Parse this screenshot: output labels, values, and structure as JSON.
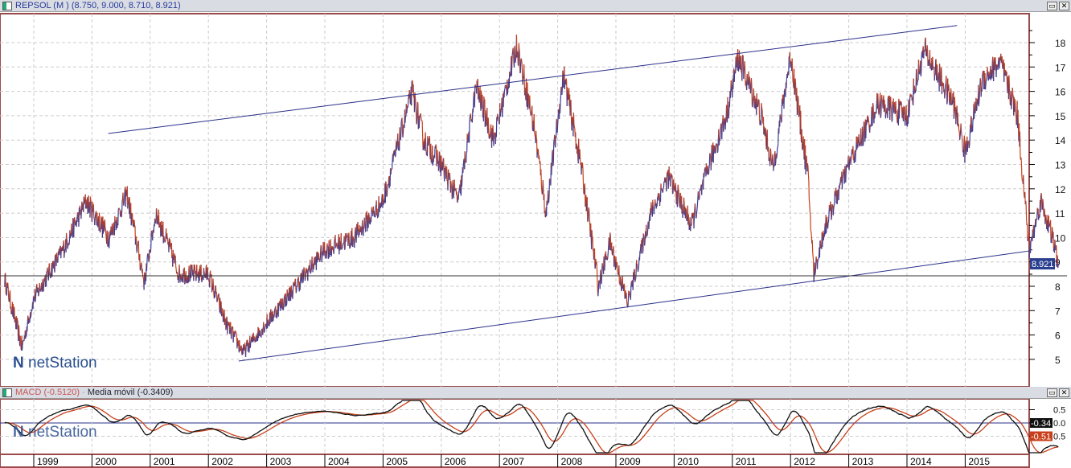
{
  "header": {
    "title": "REPSOL (M ) (8.750, 9.000, 8.710, 8.921)"
  },
  "macd_header": {
    "macd": "MACD (-0.5120)",
    "sep": " - ",
    "ma": "Media móvil (-0.3409)"
  },
  "logo": "netStation",
  "colors": {
    "up": "#3a3f9a",
    "down": "#c8401a",
    "frame": "#9a4a4a",
    "trend": "#2a2f8a"
  },
  "chart_data": [
    {
      "type": "line",
      "title": "REPSOL (M )",
      "ylim": [
        4.3,
        19.3
      ],
      "yticks": [
        5,
        6,
        7,
        8,
        9,
        10,
        11,
        12,
        13,
        14,
        15,
        16,
        17,
        18
      ],
      "last_value": "8.921",
      "anchors": [
        [
          1998.5,
          8.3
        ],
        [
          1998.8,
          5.5
        ],
        [
          1999.0,
          7.5
        ],
        [
          1999.5,
          9.5
        ],
        [
          1999.9,
          11.5
        ],
        [
          2000.3,
          10
        ],
        [
          2000.6,
          11.8
        ],
        [
          2000.9,
          8.2
        ],
        [
          2001.1,
          11
        ],
        [
          2001.5,
          8.5
        ],
        [
          2002.0,
          8.5
        ],
        [
          2002.3,
          6.5
        ],
        [
          2002.6,
          5.3
        ],
        [
          2003.0,
          6.5
        ],
        [
          2003.5,
          8.0
        ],
        [
          2004.0,
          9.5
        ],
        [
          2004.5,
          10
        ],
        [
          2005.0,
          11.5
        ],
        [
          2005.5,
          16
        ],
        [
          2005.7,
          14
        ],
        [
          2006.0,
          13
        ],
        [
          2006.3,
          11.5
        ],
        [
          2006.6,
          16.2
        ],
        [
          2006.9,
          14
        ],
        [
          2007.3,
          17.9
        ],
        [
          2007.6,
          14.5
        ],
        [
          2007.8,
          11
        ],
        [
          2008.1,
          16.7
        ],
        [
          2008.4,
          13
        ],
        [
          2008.7,
          8
        ],
        [
          2008.9,
          9.8
        ],
        [
          2009.2,
          7.3
        ],
        [
          2009.6,
          11
        ],
        [
          2009.9,
          12.5
        ],
        [
          2010.3,
          10.5
        ],
        [
          2010.6,
          13
        ],
        [
          2010.9,
          15
        ],
        [
          2011.1,
          17.4
        ],
        [
          2011.5,
          15
        ],
        [
          2011.7,
          12.8
        ],
        [
          2012.0,
          17.5
        ],
        [
          2012.3,
          12.5
        ],
        [
          2012.4,
          8.5
        ],
        [
          2012.6,
          10.5
        ],
        [
          2013.0,
          13
        ],
        [
          2013.5,
          15.5
        ],
        [
          2014.0,
          15
        ],
        [
          2014.3,
          17.7
        ],
        [
          2014.8,
          15.5
        ],
        [
          2015.0,
          13.5
        ],
        [
          2015.3,
          16.5
        ],
        [
          2015.6,
          17.2
        ],
        [
          2015.9,
          15
        ],
        [
          2016.1,
          9.5
        ],
        [
          2016.3,
          11.5
        ],
        [
          2016.5,
          10
        ],
        [
          2016.6,
          8.921
        ]
      ],
      "trendlines": [
        [
          [
            2000.28,
            14.27
          ],
          [
            2014.86,
            18.7
          ]
        ],
        [
          [
            2002.52,
            4.93
          ],
          [
            2016.1,
            9.45
          ]
        ],
        [
          [
            1998.4,
            8.43
          ],
          [
            2016.75,
            8.43
          ]
        ]
      ]
    },
    {
      "type": "line",
      "title": "MACD",
      "series": [
        {
          "name": "MACD",
          "last": "-0.51"
        },
        {
          "name": "Media móvil",
          "last": "-0.34"
        }
      ],
      "ylim": [
        -1.0,
        0.9
      ],
      "ytick_labels": [
        "0.5",
        "0.0",
        "0.5"
      ]
    }
  ],
  "xaxis": {
    "labels": [
      "1999",
      "2000",
      "2001",
      "2002",
      "2003",
      "2004",
      "2005",
      "2006",
      "2007",
      "2008",
      "2009",
      "2010",
      "2011",
      "2012",
      "2013",
      "2014",
      "2015"
    ]
  }
}
